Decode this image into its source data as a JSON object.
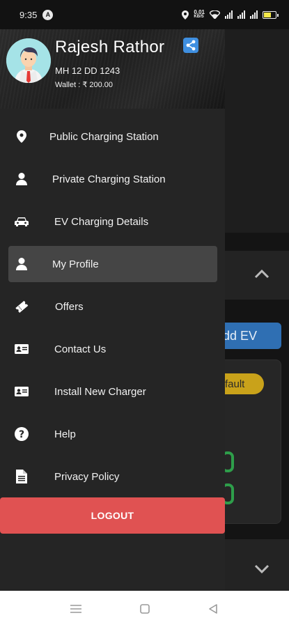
{
  "status_bar": {
    "time": "9:35",
    "app_badge": "A",
    "net_speed": "0.01",
    "net_unit": "KB/S",
    "battery_percent": 60
  },
  "background": {
    "add_ev_label": "dd EV",
    "default_label": "fault"
  },
  "drawer": {
    "user_name": "Rajesh Rathor",
    "vehicle_number": "MH 12 DD 1243",
    "wallet": "Wallet : ₹ 200.00",
    "menu": [
      {
        "label": "Public Charging Station",
        "icon": "location-pin-icon"
      },
      {
        "label": "Private Charging Station",
        "icon": "user-icon"
      },
      {
        "label": "EV Charging Details",
        "icon": "car-icon"
      },
      {
        "label": "My Profile",
        "icon": "user-icon",
        "active": true
      },
      {
        "label": "Offers",
        "icon": "ticket-icon"
      },
      {
        "label": "Contact Us",
        "icon": "id-card-icon"
      },
      {
        "label": "Install New Charger",
        "icon": "id-card-icon"
      },
      {
        "label": "Help",
        "icon": "help-circle-icon"
      },
      {
        "label": "Privacy Policy",
        "icon": "document-icon"
      }
    ],
    "logout_label": "LOGOUT"
  },
  "colors": {
    "logout": "#e05252",
    "share": "#3f8fe0",
    "active_item": "#454545",
    "drawer_bg": "#252525"
  }
}
